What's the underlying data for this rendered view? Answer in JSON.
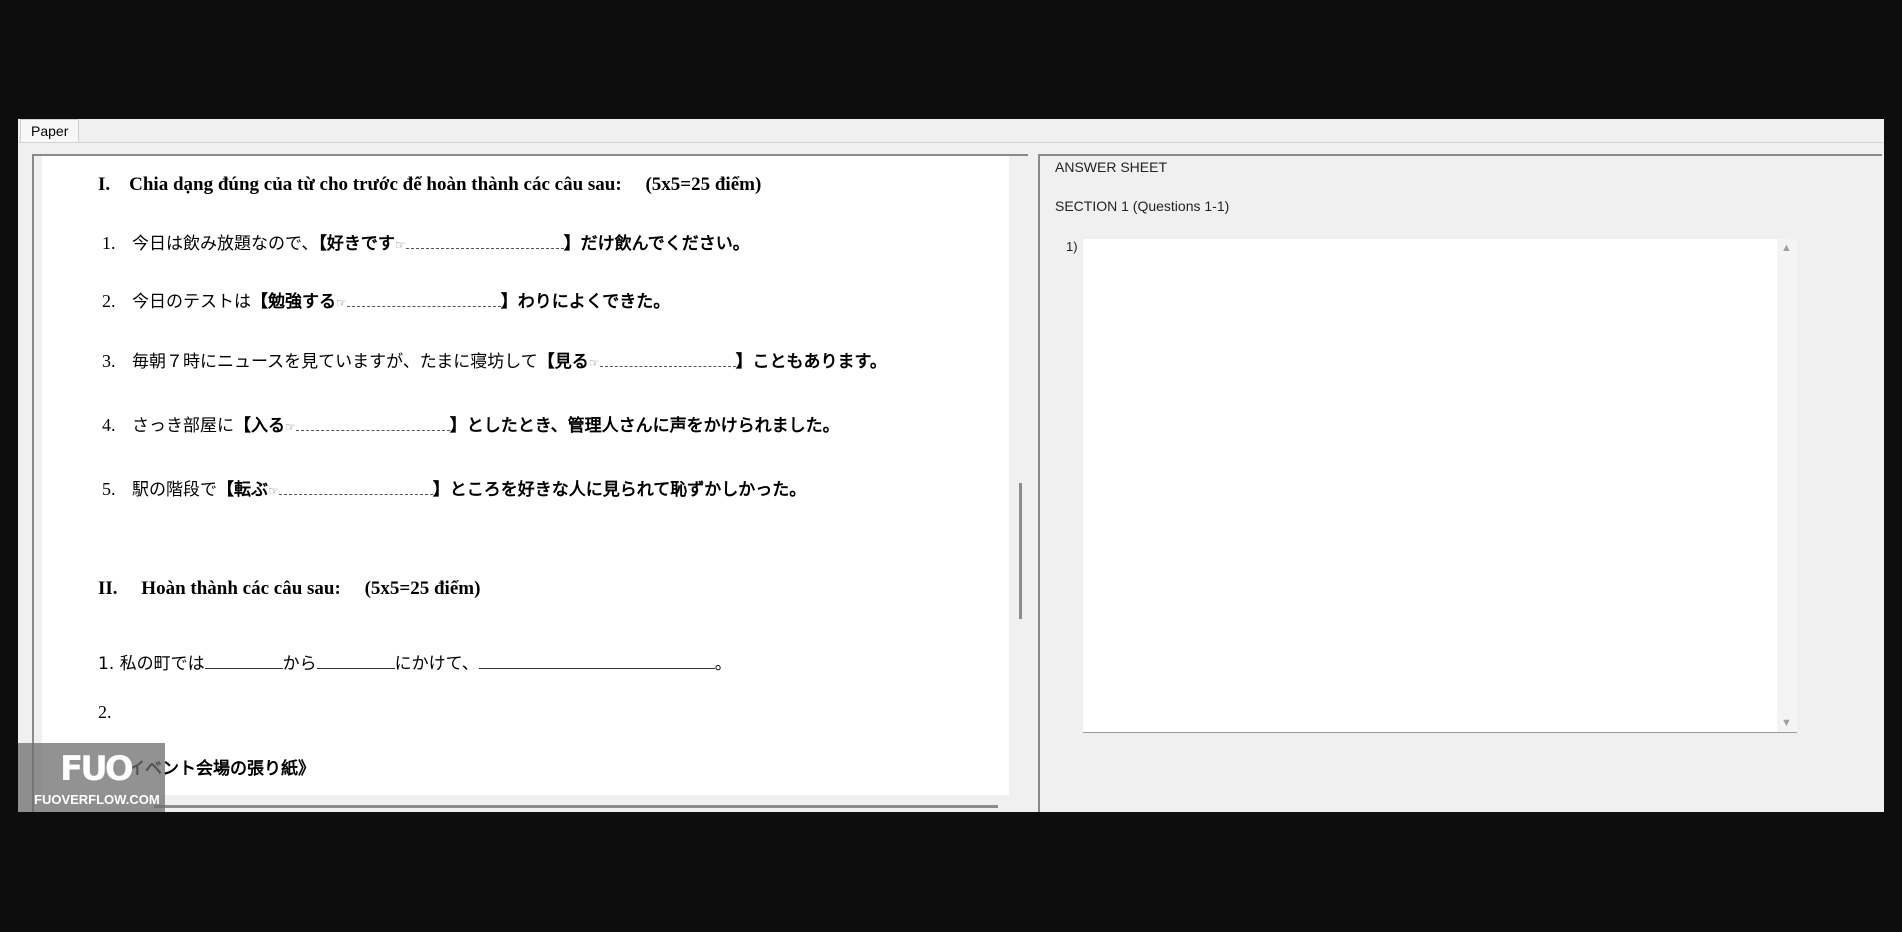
{
  "tabs": [
    {
      "label": "Paper"
    }
  ],
  "paper": {
    "section1_heading": "I. Chia dạng đúng của từ cho trước để hoàn thành các câu sau:  (5x5=25 điểm)",
    "questions": [
      {
        "num": "1.",
        "pre": "今日は飲み放題なので、",
        "bracket_word": "【好きです",
        "icon": "☞",
        "post": "】だけ飲んでください。"
      },
      {
        "num": "2.",
        "pre": "今日のテストは",
        "bracket_word": "【勉強する",
        "icon": "☞",
        "post": "】わりによくできた。"
      },
      {
        "num": "3.",
        "pre": "毎朝７時にニュースを見ていますが、たまに寝坊して",
        "bracket_word": "【見る",
        "icon": "☞",
        "post": "】こともあります。"
      },
      {
        "num": "4.",
        "pre": "さっき部屋に",
        "bracket_word": "【入る",
        "icon": "☞",
        "post": "】としたとき、管理人さんに声をかけられました。"
      },
      {
        "num": "5.",
        "pre": "駅の階段で",
        "bracket_word": "【転ぶ",
        "icon": "☞",
        "post": "】ところを好きな人に見られて恥ずかしかった。"
      }
    ],
    "section2_heading": "II.  Hoàn thành các câu sau:  (5x5=25 điểm)",
    "s2_q1": {
      "part1": "1. 私の町では",
      "part2": "から",
      "part3": "にかけて、",
      "part4": "。"
    },
    "s2_q2": "2.",
    "s2_partial": "イベント会場の張り紙》"
  },
  "answer_sheet": {
    "title": "ANSWER SHEET",
    "section": "SECTION 1 (Questions 1-1)",
    "question_label": "1)",
    "answer_value": ""
  },
  "watermark": {
    "logo": "FUO",
    "text": "FUOVERFLOW.COM"
  }
}
